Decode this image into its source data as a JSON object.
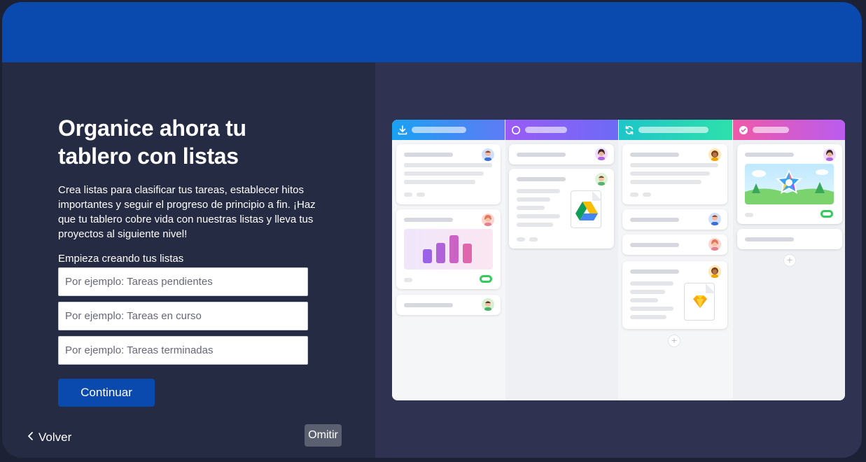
{
  "onboarding": {
    "title": "Organice ahora tu tablero con listas",
    "description": "Crea listas para clasificar tus tareas, establecer hitos importantes y seguir el progreso de principio a fin. ¡Haz que tu tablero cobre vida con nuestras listas y lleva tus proyectos al siguiente nivel!",
    "lists_label": "Empieza creando tus listas",
    "inputs": [
      {
        "value": "",
        "placeholder": "Por ejemplo: Tareas pendientes"
      },
      {
        "value": "",
        "placeholder": "Por ejemplo: Tareas en curso"
      },
      {
        "value": "",
        "placeholder": "Por ejemplo: Tareas terminadas"
      }
    ],
    "continue_label": "Continuar",
    "back_label": "Volver",
    "skip_label": "Omitir"
  },
  "colors": {
    "accent": "#0a4aaf",
    "left_panel": "#262b44",
    "right_panel": "#2f3351"
  },
  "illustration": {
    "columns": [
      {
        "icon": "download-icon",
        "gradient": [
          "#1aa1f2",
          "#5f7bf5"
        ]
      },
      {
        "icon": "circle-icon",
        "gradient": [
          "#8e5cf6",
          "#6a6cf6"
        ]
      },
      {
        "icon": "refresh-icon",
        "gradient": [
          "#1ec6c8",
          "#2be0b0"
        ]
      },
      {
        "icon": "check-circle-icon",
        "gradient": [
          "#f05aa8",
          "#b95cf0"
        ]
      }
    ],
    "card_icons": [
      "bar-chart-icon",
      "google-drive-icon",
      "sketch-icon",
      "star-icon"
    ]
  }
}
